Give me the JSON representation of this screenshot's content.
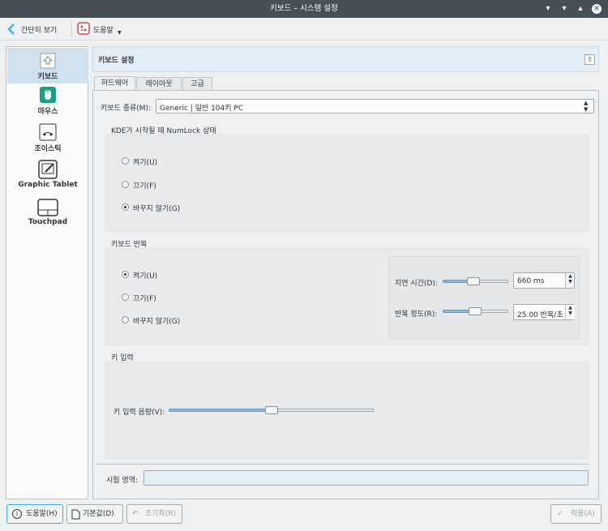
{
  "window": {
    "title": "키보드 – 시스템 설정"
  },
  "toolbar": {
    "back_label": "간단히 보기",
    "help_label": "도움말"
  },
  "sidebar": {
    "items": [
      {
        "label": "키보드",
        "icon": "keyboard-icon"
      },
      {
        "label": "마우스",
        "icon": "mouse-icon"
      },
      {
        "label": "조이스틱",
        "icon": "joystick-icon"
      },
      {
        "label": "Graphic Tablet",
        "icon": "tablet-icon"
      },
      {
        "label": "Touchpad",
        "icon": "touchpad-icon"
      }
    ]
  },
  "panel": {
    "title": "키보드 설정"
  },
  "tabs": [
    {
      "label": "하드웨어"
    },
    {
      "label": "레이아웃"
    },
    {
      "label": "고급"
    }
  ],
  "hardware": {
    "model_label": "키보드 종류(M):",
    "model_value": "Generic | 일반 104키 PC",
    "numlock": {
      "title": "KDE가 시작될 때 NumLock 상태",
      "options": [
        "켜기(U)",
        "끄기(F)",
        "바꾸지 않기(G)"
      ],
      "selected": 2
    },
    "repeat": {
      "title": "키보드 반복",
      "options": [
        "켜기(U)",
        "끄기(F)",
        "바꾸지 않기(G)"
      ],
      "selected": 0,
      "delay_label": "지연 시간(D):",
      "delay_value": "660 ms",
      "rate_label": "반복 정도(R):",
      "rate_value": "25.00 반복/초"
    },
    "click": {
      "title": "키 입력",
      "volume_label": "키 입력 음량(V):"
    },
    "test_label": "시험 영역:"
  },
  "buttons": {
    "help": "도움말(H)",
    "defaults": "기본값(D)",
    "reset": "초기화(R)",
    "apply": "적용(A)"
  },
  "colors": {
    "accent": "#3daee9",
    "selection": "#cfe0ef"
  }
}
